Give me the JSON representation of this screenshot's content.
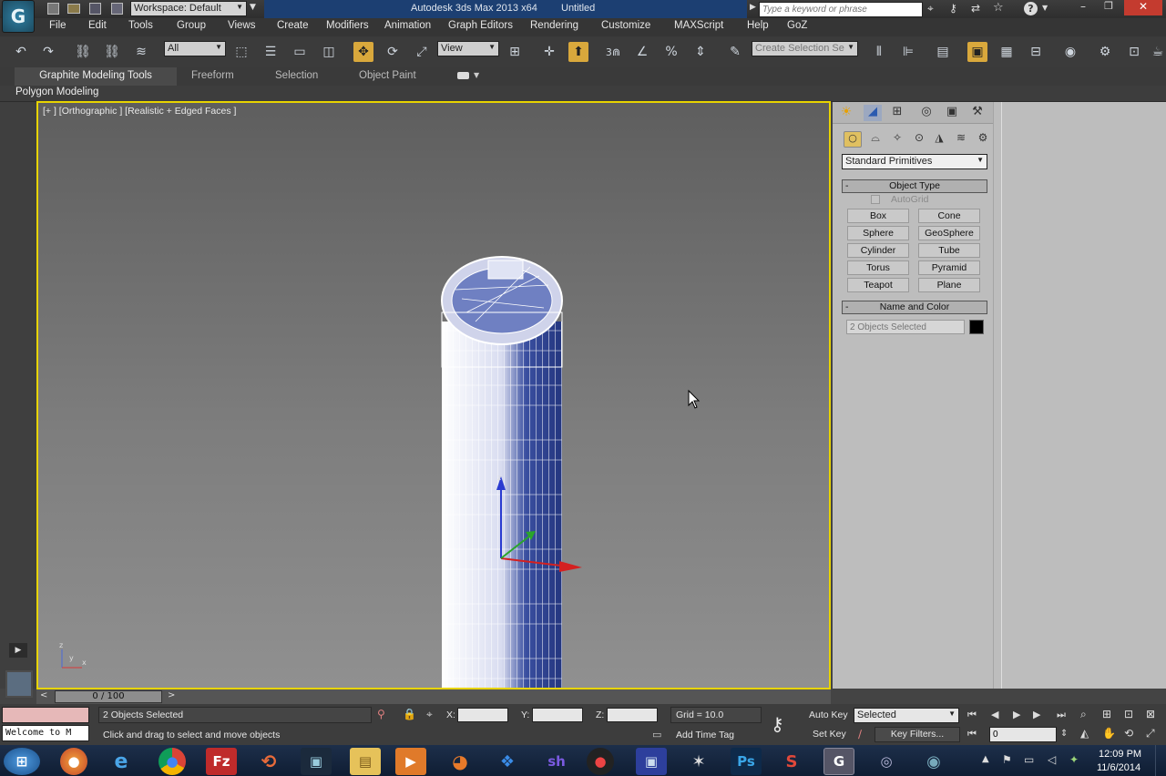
{
  "titlebar": {
    "workspace": "Workspace: Default",
    "app_title": "Autodesk 3ds Max  2013 x64",
    "doc_title": "Untitled",
    "search_placeholder": "Type a keyword or phrase"
  },
  "menu": [
    "File",
    "Edit",
    "Tools",
    "Group",
    "Views",
    "Create",
    "Modifiers",
    "Animation",
    "Graph Editors",
    "Rendering",
    "Customize",
    "MAXScript",
    "Help",
    "GoZ"
  ],
  "toolbar": {
    "filter_value": "All",
    "refcoord_value": "View",
    "selection_set_placeholder": "Create Selection Se",
    "snap_label": "3"
  },
  "ribbon": {
    "tabs": [
      "Graphite Modeling Tools",
      "Freeform",
      "Selection",
      "Object Paint"
    ],
    "sub": "Polygon Modeling"
  },
  "viewport": {
    "label": "[+ ] [Orthographic ] [Realistic + Edged Faces ]",
    "axis_x": "x",
    "axis_y": "y",
    "axis_z": "z"
  },
  "command_panel": {
    "category": "Standard Primitives",
    "object_type_title": "Object Type",
    "autogrid": "AutoGrid",
    "buttons": [
      "Box",
      "Cone",
      "Sphere",
      "GeoSphere",
      "Cylinder",
      "Tube",
      "Torus",
      "Pyramid",
      "Teapot",
      "Plane"
    ],
    "name_color_title": "Name and Color",
    "name_value": "2 Objects Selected",
    "color": "#000000"
  },
  "timeline": {
    "frame": "0 / 100"
  },
  "status": {
    "selection_info": "2 Objects Selected",
    "prompt": "Click and drag to select and move objects",
    "maxscript": "Welcome to M",
    "x_label": "X:",
    "y_label": "Y:",
    "z_label": "Z:",
    "grid": "Grid = 10.0",
    "add_time_tag": "Add Time Tag",
    "auto_key": "Auto Key",
    "set_key": "Set Key",
    "key_mode": "Selected",
    "key_filters": "Key Filters...",
    "frame_value": "0"
  },
  "taskbar": {
    "time": "12:09 PM",
    "date": "11/6/2014"
  }
}
